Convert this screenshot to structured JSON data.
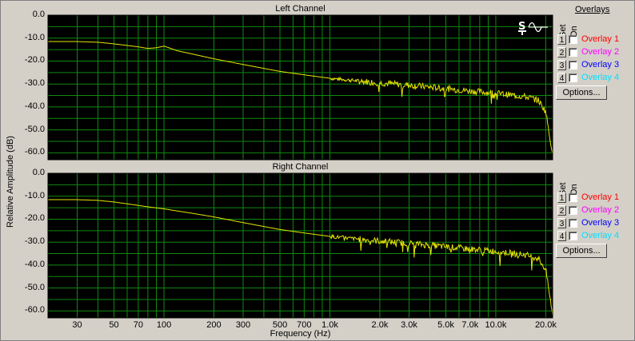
{
  "overlays_title": "Overlays",
  "panel_labels": {
    "set": "Set",
    "on": "On"
  },
  "options_label": "Options...",
  "colors": {
    "plot_bg": "#000000",
    "grid": "#0f8a0f",
    "trace": "#e6e600",
    "overlay1": "#ff0000",
    "overlay2": "#ff00ff",
    "overlay3": "#0000ff",
    "overlay4": "#00e0ff"
  },
  "overlays": [
    {
      "set": "1",
      "label": "Overlay 1",
      "color": "#ff0000",
      "on": false
    },
    {
      "set": "2",
      "label": "Overlay 2",
      "color": "#ff00ff",
      "on": false
    },
    {
      "set": "3",
      "label": "Overlay 3",
      "color": "#0000ff",
      "on": false
    },
    {
      "set": "4",
      "label": "Overlay 4",
      "color": "#00e0ff",
      "on": false
    }
  ],
  "icon": "sine-wave-scale-icon",
  "chart_data": [
    {
      "type": "line",
      "title": "Left Channel",
      "xlabel": "Frequency (Hz)",
      "ylabel": "Relative Amplitude (dB)",
      "xscale": "log",
      "xlim": [
        20,
        22000
      ],
      "ylim": [
        -63,
        0
      ],
      "grid": true,
      "yticks": [
        0,
        -10,
        -20,
        -30,
        -40,
        -50,
        -60
      ],
      "ytick_labels": [
        "0.0",
        "-10.0",
        "-20.0",
        "-30.0",
        "-40.0",
        "-50.0",
        "-60.0"
      ],
      "xticks": [
        30,
        50,
        70,
        100,
        200,
        300,
        500,
        700,
        1000,
        2000,
        3000,
        5000,
        7000,
        10000,
        20000
      ],
      "xtick_labels": [
        "30",
        "50",
        "70",
        "100",
        "200",
        "300",
        "500",
        "700",
        "1.0k",
        "2.0k",
        "3.0k",
        "5.0k",
        "7.0k",
        "10.0k",
        "20.0k"
      ],
      "series": [
        {
          "x": [
            20,
            30,
            40,
            50,
            60,
            70,
            80,
            90,
            100,
            110,
            120,
            150,
            200,
            300,
            500,
            700,
            1000,
            2000,
            3000,
            5000,
            7000,
            10000,
            15000,
            18000,
            20000,
            21000,
            22000
          ],
          "y": [
            -11.5,
            -11.5,
            -11.8,
            -12.5,
            -13.2,
            -13.8,
            -14.5,
            -14.2,
            -13.5,
            -14.5,
            -15.5,
            -17,
            -19,
            -21.5,
            -24.5,
            -26,
            -27.5,
            -29.5,
            -30.5,
            -32,
            -33,
            -34,
            -35.5,
            -37,
            -42,
            -52,
            -60
          ]
        }
      ]
    },
    {
      "type": "line",
      "title": "Right Channel",
      "xlabel": "Frequency (Hz)",
      "ylabel": "Relative Amplitude (dB)",
      "xscale": "log",
      "xlim": [
        20,
        22000
      ],
      "ylim": [
        -63,
        0
      ],
      "grid": true,
      "yticks": [
        0,
        -10,
        -20,
        -30,
        -40,
        -50,
        -60
      ],
      "ytick_labels": [
        "0.0",
        "-10.0",
        "-20.0",
        "-30.0",
        "-40.0",
        "-50.0",
        "-60.0"
      ],
      "xticks": [
        30,
        50,
        70,
        100,
        200,
        300,
        500,
        700,
        1000,
        2000,
        3000,
        5000,
        7000,
        10000,
        20000
      ],
      "xtick_labels": [
        "30",
        "50",
        "70",
        "100",
        "200",
        "300",
        "500",
        "700",
        "1.0k",
        "2.0k",
        "3.0k",
        "5.0k",
        "7.0k",
        "10.0k",
        "20.0k"
      ],
      "series": [
        {
          "x": [
            20,
            30,
            40,
            50,
            60,
            70,
            80,
            100,
            150,
            200,
            300,
            500,
            700,
            1000,
            2000,
            3000,
            5000,
            7000,
            10000,
            15000,
            18000,
            20000,
            21000,
            22000
          ],
          "y": [
            -11.5,
            -11.5,
            -11.8,
            -12.5,
            -13.3,
            -14,
            -14.6,
            -15.5,
            -17.5,
            -19,
            -21.5,
            -24.5,
            -26,
            -27.5,
            -29.5,
            -30.5,
            -32,
            -33,
            -34,
            -35.5,
            -37,
            -42,
            -52,
            -61
          ]
        }
      ]
    }
  ]
}
